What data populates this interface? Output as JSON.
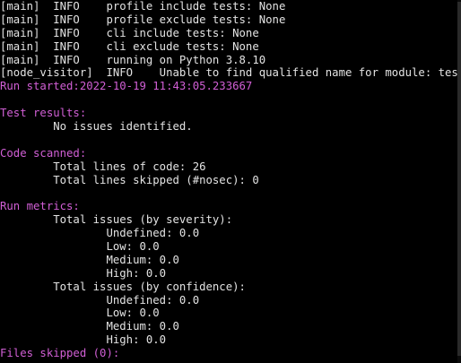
{
  "terminal": {
    "colors": {
      "background": "#000000",
      "text": "#e3e3e3",
      "heading": "#d15fd5"
    },
    "lines": [
      {
        "text": "[main]  INFO    profile include tests: None",
        "style": "plain"
      },
      {
        "text": "[main]  INFO    profile exclude tests: None",
        "style": "plain"
      },
      {
        "text": "[main]  INFO    cli include tests: None",
        "style": "plain"
      },
      {
        "text": "[main]  INFO    cli exclude tests: None",
        "style": "plain"
      },
      {
        "text": "[main]  INFO    running on Python 3.8.10",
        "style": "plain"
      },
      {
        "text": "[node_visitor]  INFO    Unable to find qualified name for module: test.py",
        "style": "plain"
      },
      {
        "text": "Run started:2022-10-19 11:43:05.233667",
        "style": "magenta"
      },
      {
        "text": "",
        "style": "plain"
      },
      {
        "text": "Test results:",
        "style": "magenta"
      },
      {
        "text": "        No issues identified.",
        "style": "plain"
      },
      {
        "text": "",
        "style": "plain"
      },
      {
        "text": "Code scanned:",
        "style": "magenta"
      },
      {
        "text": "        Total lines of code: 26",
        "style": "plain"
      },
      {
        "text": "        Total lines skipped (#nosec): 0",
        "style": "plain"
      },
      {
        "text": "",
        "style": "plain"
      },
      {
        "text": "Run metrics:",
        "style": "magenta"
      },
      {
        "text": "        Total issues (by severity):",
        "style": "plain"
      },
      {
        "text": "                Undefined: 0.0",
        "style": "plain"
      },
      {
        "text": "                Low: 0.0",
        "style": "plain"
      },
      {
        "text": "                Medium: 0.0",
        "style": "plain"
      },
      {
        "text": "                High: 0.0",
        "style": "plain"
      },
      {
        "text": "        Total issues (by confidence):",
        "style": "plain"
      },
      {
        "text": "                Undefined: 0.0",
        "style": "plain"
      },
      {
        "text": "                Low: 0.0",
        "style": "plain"
      },
      {
        "text": "                Medium: 0.0",
        "style": "plain"
      },
      {
        "text": "                High: 0.0",
        "style": "plain"
      },
      {
        "text": "Files skipped (0):",
        "style": "magenta"
      }
    ]
  }
}
